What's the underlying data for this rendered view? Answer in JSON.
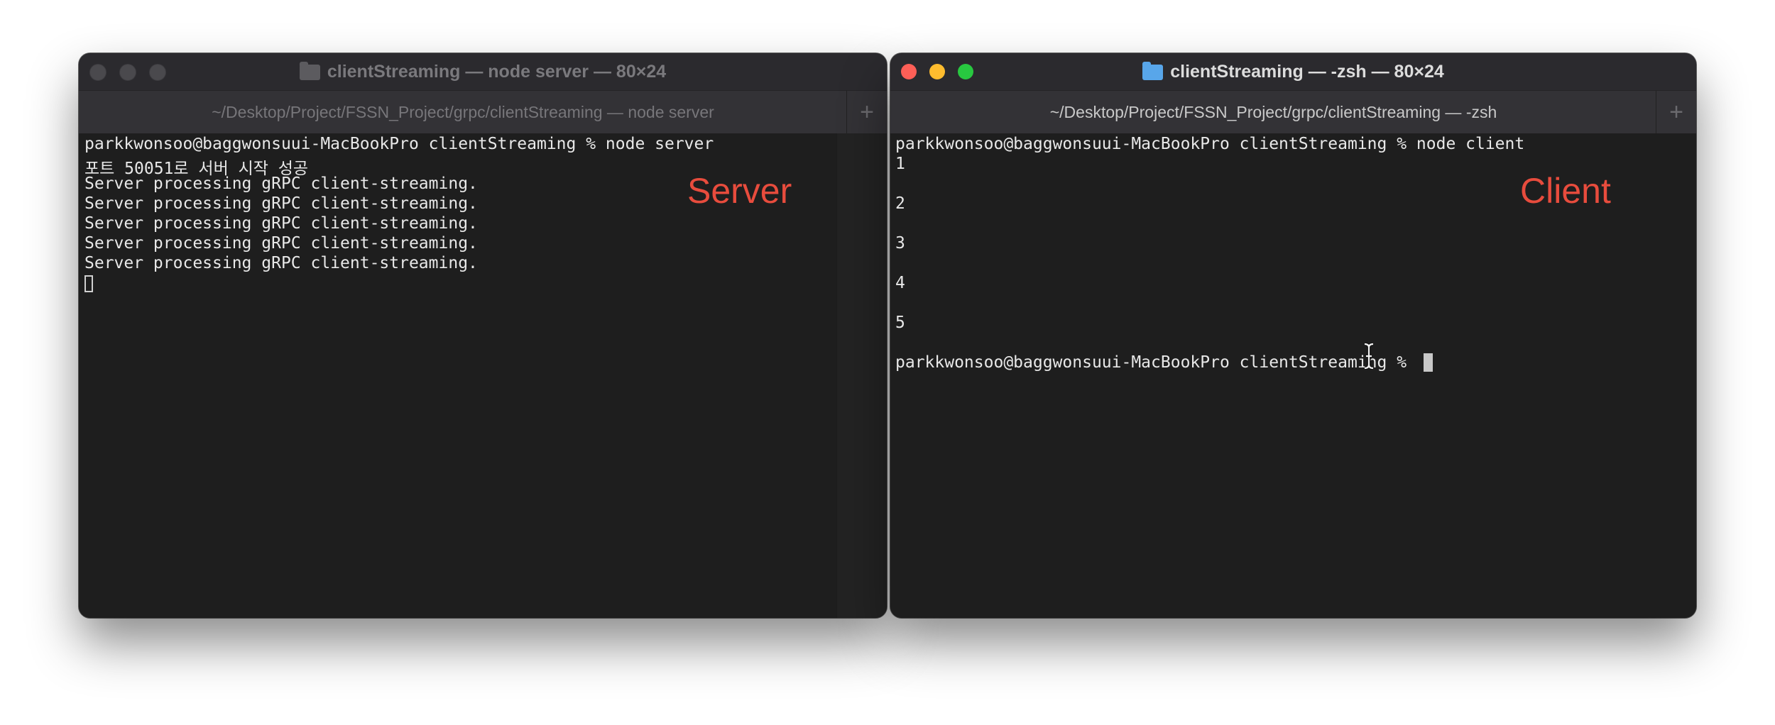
{
  "colors": {
    "close": "#fe5f57",
    "minimize": "#febc2e",
    "zoom": "#28c840",
    "inactive_light": "#4a494d",
    "label": "#e84c3d",
    "folder_active": "#58a6ea",
    "folder_inactive": "#5c5b5f"
  },
  "left_window": {
    "title": "clientStreaming — node server — 80×24",
    "tab_label": "~/Desktop/Project/FSSN_Project/grpc/clientStreaming — node server",
    "new_tab": "+",
    "overlay_label": "Server",
    "lines": [
      "parkkwonsoo@baggwonsuui-MacBookPro clientStreaming % node server",
      "포트 50051로 서버 시작 성공",
      "Server processing gRPC client-streaming.",
      "Server processing gRPC client-streaming.",
      "Server processing gRPC client-streaming.",
      "Server processing gRPC client-streaming.",
      "Server processing gRPC client-streaming."
    ]
  },
  "right_window": {
    "title": "clientStreaming — -zsh — 80×24",
    "tab_label": "~/Desktop/Project/FSSN_Project/grpc/clientStreaming — -zsh",
    "new_tab": "+",
    "overlay_label": "Client",
    "lines": [
      "parkkwonsoo@baggwonsuui-MacBookPro clientStreaming % node client",
      "1",
      "",
      "2",
      "",
      "3",
      "",
      "4",
      "",
      "5",
      "",
      "parkkwonsoo@baggwonsuui-MacBookPro clientStreaming % "
    ]
  }
}
